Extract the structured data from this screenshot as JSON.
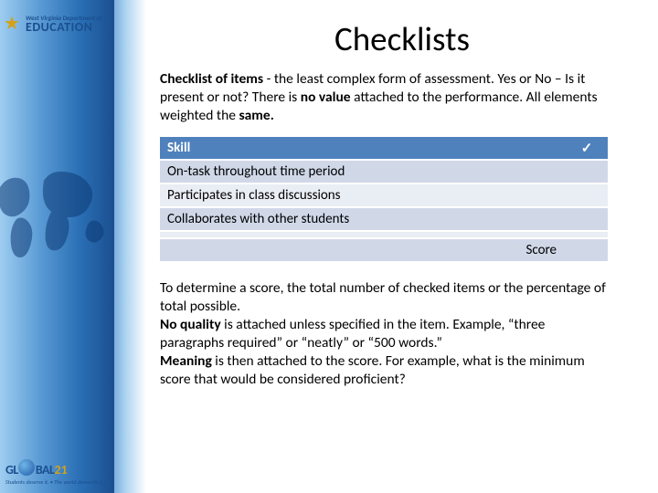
{
  "branding": {
    "state_line": "West Virginia Department of",
    "main_word": "EDUCATION",
    "global_prefix": "GL",
    "global_suffix": "BAL",
    "global_number": "21",
    "tagline": "Students deserve it. • The world demands it."
  },
  "title": "Checklists",
  "intro": {
    "lead_bold": "Checklist of items ",
    "lead_rest": "- the least complex form of assessment. Yes or No – Is it present or not? There is ",
    "no_value": "no value",
    "after_no_value": " attached to the performance. All elements weighted the ",
    "same": "same.",
    "tail": ""
  },
  "table": {
    "header_skill": "Skill",
    "header_check": "✓",
    "rows": [
      "On-task throughout time period",
      "Participates in class discussions",
      "Collaborates with other students",
      ""
    ],
    "score_label": "Score"
  },
  "outro": {
    "l1a": "To determine a score, the total number of checked items or the percentage of total possible.",
    "l2_bold": "No quality",
    "l2_rest": " is attached unless specified in the item. Example, “three paragraphs required” or “neatly” or “500 words.”",
    "l3_bold": "Meaning",
    "l3_rest": " is then attached to the score. For example, what is the minimum score that would be considered proficient?"
  }
}
